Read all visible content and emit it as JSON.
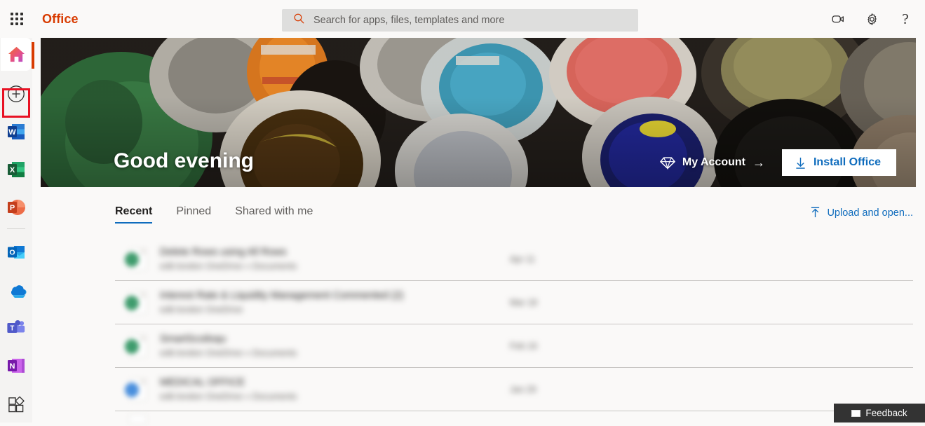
{
  "header": {
    "app_launcher_icon": "waffle-grid-icon",
    "brand": "Office",
    "search": {
      "icon": "search-icon",
      "placeholder": "Search for apps, files, templates and more",
      "value": ""
    },
    "icons": [
      {
        "name": "meeting-video-icon",
        "label": "Meet now"
      },
      {
        "name": "gear-icon",
        "label": "Settings"
      },
      {
        "name": "help-question-icon",
        "label": "Help"
      }
    ],
    "help_glyph": "?"
  },
  "sidebar": {
    "accent_color": "#d83b01",
    "highlight_color": "#e81123",
    "items": [
      {
        "name": "home",
        "icon": "home-icon",
        "label": "Home",
        "selected": true
      },
      {
        "name": "create",
        "icon": "plus-circle-icon",
        "label": "Create"
      },
      {
        "name": "word",
        "icon": "word-icon",
        "label": "Word",
        "highlighted": true
      },
      {
        "name": "excel",
        "icon": "excel-icon",
        "label": "Excel"
      },
      {
        "name": "powerpoint",
        "icon": "powerpoint-icon",
        "label": "PowerPoint"
      },
      {
        "name": "outlook",
        "icon": "outlook-icon",
        "label": "Outlook"
      },
      {
        "name": "onedrive",
        "icon": "onedrive-icon",
        "label": "OneDrive"
      },
      {
        "name": "teams",
        "icon": "teams-icon",
        "label": "Teams"
      },
      {
        "name": "onenote",
        "icon": "onenote-icon",
        "label": "OneNote"
      },
      {
        "name": "allapps",
        "icon": "all-apps-icon",
        "label": "All apps"
      }
    ]
  },
  "hero": {
    "greeting": "Good evening",
    "my_account": {
      "label": "My Account",
      "icon": "diamond-icon",
      "arrow": "→"
    },
    "install": {
      "label": "Install Office",
      "icon": "download-arrow-icon"
    }
  },
  "main": {
    "tabs": [
      {
        "label": "Recent",
        "active": true
      },
      {
        "label": "Pinned",
        "active": false
      },
      {
        "label": "Shared with me",
        "active": false
      }
    ],
    "upload": {
      "label": "Upload and open...",
      "icon": "upload-arrow-icon"
    },
    "files": [
      {
        "name": "Delete Rows using All Rows",
        "subtitle": "edit-london OneDrive » Documents",
        "date": "Apr 11",
        "icon_color": "#3f9c6d"
      },
      {
        "name": "Interest Rate & Liquidity Management Commented (2)",
        "subtitle": "edit-london OneDrive",
        "date": "Mar 18",
        "icon_color": "#3f9c6d"
      },
      {
        "name": "SmartScoiloqu",
        "subtitle": "edit-london OneDrive » Documents",
        "date": "Feb 16",
        "icon_color": "#3f9c6d"
      },
      {
        "name": "MEDICAL OFFICE",
        "subtitle": "edit-london OneDrive » Documents",
        "date": "Jan 29",
        "icon_color": "#4a8fdd"
      }
    ]
  },
  "feedback": {
    "label": "Feedback",
    "icon": "flag-icon"
  }
}
